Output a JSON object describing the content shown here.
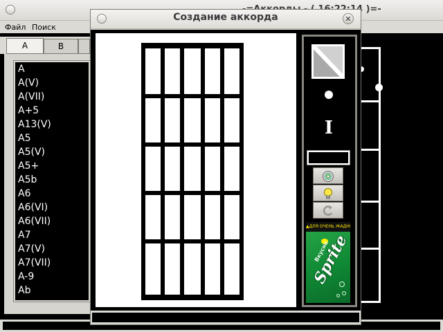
{
  "main_window": {
    "title": "-=Аккорды - ( 16:22:14 )=-",
    "menu": [
      "Файл",
      "Поиск"
    ],
    "tabs": [
      "A",
      "B",
      ""
    ],
    "chords": [
      "A",
      "A(V)",
      "A(VII)",
      "A+5",
      "A13(V)",
      "A5",
      "A5(V)",
      "A5+",
      "A5b",
      "A6",
      "A6(VI)",
      "A6(VII)",
      "A7",
      "A7(V)",
      "A7(VII)",
      "A-9",
      "Ab"
    ]
  },
  "dialog": {
    "title": "Создание аккорда",
    "close_symbol": "✕",
    "tools": {
      "ibeam_symbol": "I",
      "input_value": "",
      "buttons": [
        "save-icon",
        "lightbulb-icon",
        "refresh-icon"
      ],
      "button_glyphs": [
        "◎",
        "💡",
        "C"
      ]
    },
    "ad": {
      "banner": "▲ДЛЯ ОЧЕНЬ ЖАДНЫХ▲",
      "sub": "Вкусно",
      "brand": "Sprite"
    },
    "fretboard": {
      "strings": 5,
      "frets": 5
    }
  }
}
